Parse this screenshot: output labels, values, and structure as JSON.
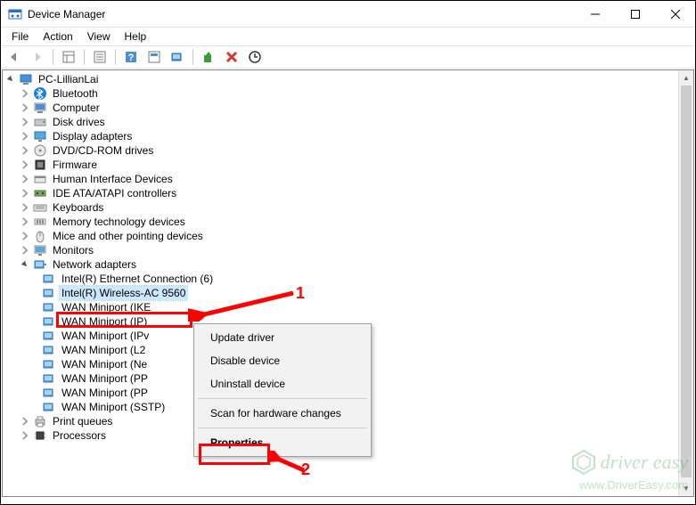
{
  "window": {
    "title": "Device Manager"
  },
  "menu": {
    "file": "File",
    "action": "Action",
    "view": "View",
    "help": "Help"
  },
  "tree": {
    "root": "PC-LillianLai",
    "items": [
      {
        "label": "Bluetooth",
        "icon": "bluetooth"
      },
      {
        "label": "Computer",
        "icon": "computer"
      },
      {
        "label": "Disk drives",
        "icon": "disk"
      },
      {
        "label": "Display adapters",
        "icon": "display"
      },
      {
        "label": "DVD/CD-ROM drives",
        "icon": "dvd"
      },
      {
        "label": "Firmware",
        "icon": "firmware"
      },
      {
        "label": "Human Interface Devices",
        "icon": "hid"
      },
      {
        "label": "IDE ATA/ATAPI controllers",
        "icon": "ide"
      },
      {
        "label": "Keyboards",
        "icon": "keyboard"
      },
      {
        "label": "Memory technology devices",
        "icon": "memory"
      },
      {
        "label": "Mice and other pointing devices",
        "icon": "mouse"
      },
      {
        "label": "Monitors",
        "icon": "monitor"
      },
      {
        "label": "Network adapters",
        "icon": "network",
        "expanded": true,
        "children": [
          {
            "label": "Intel(R) Ethernet Connection (6)"
          },
          {
            "label": "Intel(R) Wireless-AC 9560",
            "selected": true
          },
          {
            "label": "WAN Miniport (IKE"
          },
          {
            "label": "WAN Miniport (IP)"
          },
          {
            "label": "WAN Miniport (IPv"
          },
          {
            "label": "WAN Miniport (L2"
          },
          {
            "label": "WAN Miniport (Ne"
          },
          {
            "label": "WAN Miniport (PP"
          },
          {
            "label": "WAN Miniport (PP"
          },
          {
            "label": "WAN Miniport (SSTP)"
          }
        ]
      },
      {
        "label": "Print queues",
        "icon": "print"
      },
      {
        "label": "Processors",
        "icon": "processor"
      }
    ]
  },
  "context_menu": {
    "update": "Update driver",
    "disable": "Disable device",
    "uninstall": "Uninstall device",
    "scan": "Scan for hardware changes",
    "properties": "Properties"
  },
  "annotations": {
    "one": "1",
    "two": "2"
  },
  "watermark": {
    "brand": "driver easy",
    "site": "www.DriverEasy.com"
  }
}
